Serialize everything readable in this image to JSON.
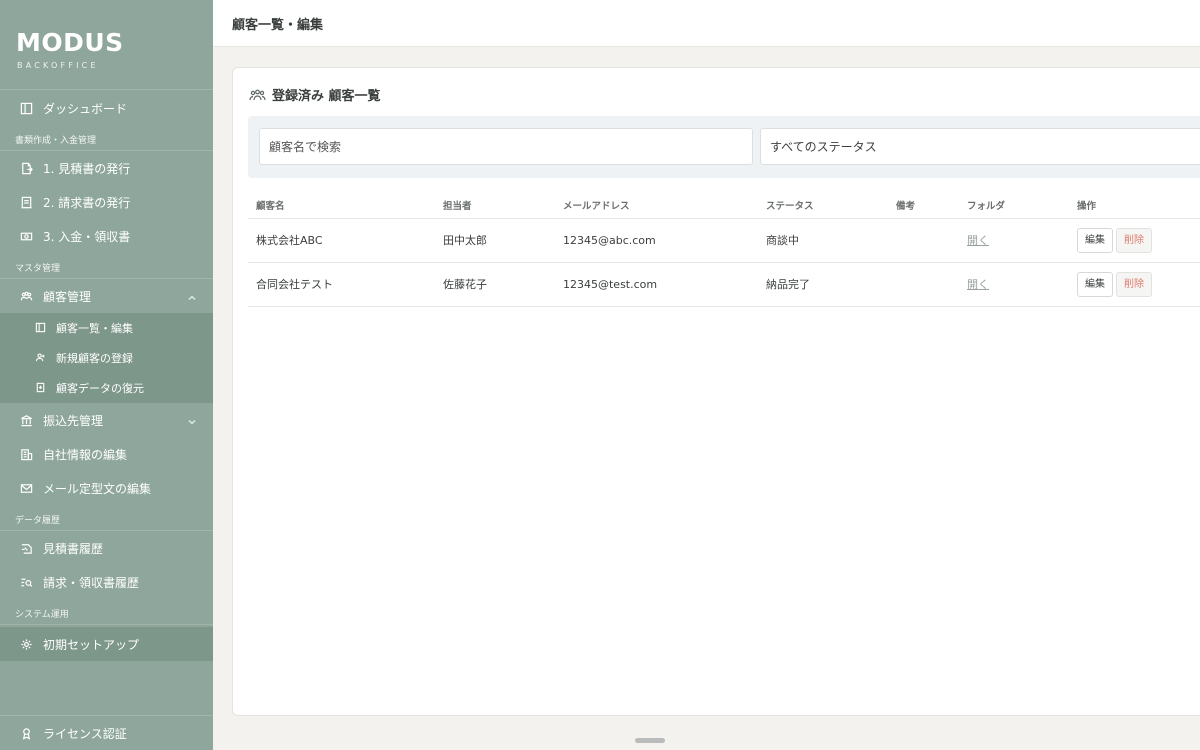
{
  "brand": {
    "name": "MODUS",
    "sub": "BACKOFFICE"
  },
  "header": {
    "title": "顧客一覧・編集"
  },
  "sidebar": {
    "dashboard": "ダッシュボード",
    "sections": {
      "documents": "書類作成・入金管理",
      "master": "マスタ管理",
      "history": "データ履歴",
      "system": "システム運用"
    },
    "documents_items": [
      "1. 見積書の発行",
      "2. 請求書の発行",
      "3. 入金・領収書"
    ],
    "customer_group": "顧客管理",
    "customer_sub": [
      "顧客一覧・編集",
      "新規顧客の登録",
      "顧客データの復元"
    ],
    "transfer": "振込先管理",
    "company": "自社情報の編集",
    "mail_template": "メール定型文の編集",
    "history_items": [
      "見積書履歴",
      "請求・領収書履歴"
    ],
    "setup": "初期セットアップ",
    "license": "ライセンス認証"
  },
  "card": {
    "title": "登録済み 顧客一覧"
  },
  "filters": {
    "search_placeholder": "顧客名で検索",
    "status_value": "すべてのステータス"
  },
  "table": {
    "columns": [
      "顧客名",
      "担当者",
      "メールアドレス",
      "ステータス",
      "備考",
      "フォルダ",
      "操作"
    ],
    "rows": [
      {
        "name": "株式会社ABC",
        "contact": "田中太郎",
        "email": "12345@abc.com",
        "status": "商談中",
        "note": "",
        "folder": "開く",
        "edit": "編集",
        "delete": "削除"
      },
      {
        "name": "合同会社テスト",
        "contact": "佐藤花子",
        "email": "12345@test.com",
        "status": "納品完了",
        "note": "",
        "folder": "開く",
        "edit": "編集",
        "delete": "削除"
      }
    ]
  }
}
